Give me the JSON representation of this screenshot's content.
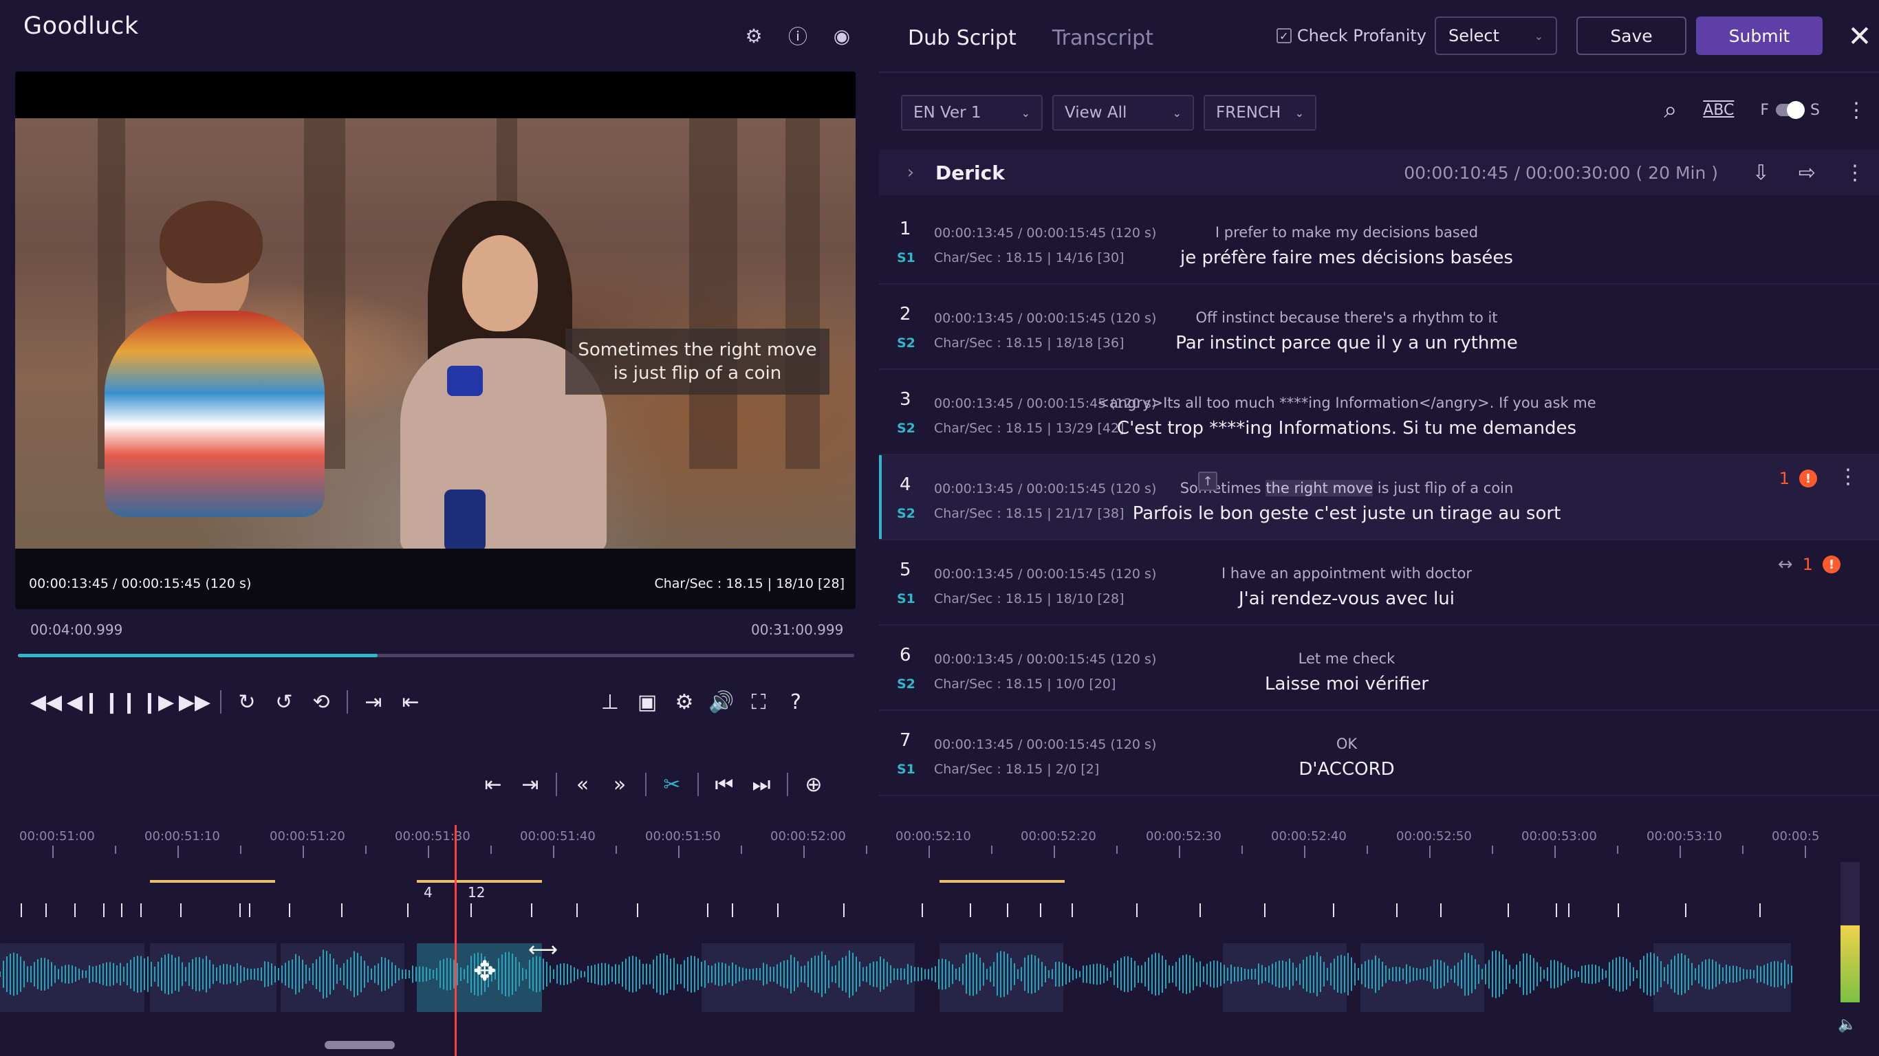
{
  "app": {
    "title": "Goodluck",
    "top_icons": [
      "gear-icon",
      "info-icon",
      "eye-icon"
    ]
  },
  "video": {
    "subtitle_line1": "Sometimes the right move",
    "subtitle_line2": "is just flip of a coin",
    "timecode": "00:00:13:45 / 00:00:15:45 (120 s)",
    "charsec": "Char/Sec : 18.15  |  18/10 [28]",
    "time_start": "00:04:00.999",
    "time_end": "00:31:00.999",
    "progress_percent": 43
  },
  "controls": {
    "row1_left": [
      {
        "name": "rewind-icon",
        "glyph": "◀◀"
      },
      {
        "name": "frame-back-icon",
        "glyph": "◀❙"
      },
      {
        "name": "pause-icon",
        "glyph": "❙❙"
      },
      {
        "name": "frame-forward-icon",
        "glyph": "❙▶"
      },
      {
        "name": "fast-forward-icon",
        "glyph": "▶▶"
      }
    ],
    "row1_mid": [
      {
        "name": "replay-10-icon",
        "glyph": "↻"
      },
      {
        "name": "forward-10-icon",
        "glyph": "↺"
      },
      {
        "name": "loop-icon",
        "glyph": "⟲"
      }
    ],
    "row1_mark": [
      {
        "name": "mark-in-icon",
        "glyph": "⇥"
      },
      {
        "name": "mark-out-icon",
        "glyph": "⇤"
      }
    ],
    "row1_right": [
      {
        "name": "pin-icon",
        "glyph": "⊥"
      },
      {
        "name": "subtitle-window-icon",
        "glyph": "▣"
      },
      {
        "name": "settings-icon",
        "glyph": "⚙"
      },
      {
        "name": "volume-icon",
        "glyph": "🔊"
      },
      {
        "name": "fullscreen-icon",
        "glyph": "⛶"
      },
      {
        "name": "help-icon",
        "glyph": "?"
      }
    ],
    "row2": [
      {
        "name": "extend-left-icon",
        "glyph": "⇤"
      },
      {
        "name": "extend-right-icon",
        "glyph": "⇥"
      },
      {
        "name": "prev-cue-icon",
        "glyph": "«"
      },
      {
        "name": "next-cue-icon",
        "glyph": "»"
      },
      {
        "name": "split-icon",
        "glyph": "✂"
      },
      {
        "name": "go-start-icon",
        "glyph": "⏮"
      },
      {
        "name": "go-end-icon",
        "glyph": "⏭"
      },
      {
        "name": "add-cue-icon",
        "glyph": "⊕"
      }
    ]
  },
  "header": {
    "tabs": [
      "Dub Script",
      "Transcript"
    ],
    "check_profanity": "Check Profanity",
    "select_label": "Select",
    "save_label": "Save",
    "submit_label": "Submit"
  },
  "filters": {
    "version": "EN Ver 1",
    "view": "View All",
    "language": "FRENCH",
    "toggle_left": "F",
    "toggle_right": "S",
    "spell_label": "ABC"
  },
  "speaker": {
    "name": "Derick",
    "time": "00:00:10:45 / 00:00:30:00 ( 20 Min )"
  },
  "lines": [
    {
      "num": "1",
      "spk": "S1",
      "time": "00:00:13:45 / 00:00:15:45 (120 s)",
      "cps": "Char/Sec : 18.15  |  14/16 [30]",
      "src": "I prefer to make  my decisions based",
      "tgt": "je préfère faire mes décisions basées"
    },
    {
      "num": "2",
      "spk": "S2",
      "time": "00:00:13:45 / 00:00:15:45 (120 s)",
      "cps": "Char/Sec : 18.15  |  18/18 [36]",
      "src": "Off instinct because there's a rhythm to it",
      "tgt": "Par instinct parce que il y a un rythme"
    },
    {
      "num": "3",
      "spk": "S2",
      "time": "00:00:13:45 / 00:00:15:45 (120 s)",
      "cps": "Char/Sec : 18.15  |  13/29 [42]",
      "src": "<angry>Its all too much ****ing Information</angry>. If you ask me",
      "tgt": "C'est trop ****ing Informations. Si tu me demandes"
    },
    {
      "num": "4",
      "spk": "S2",
      "time": "00:00:13:45 / 00:00:15:45 (120 s)",
      "cps": "Char/Sec : 18.15  |  21/17 [38]",
      "src_a": "Sometimes ",
      "src_hl": "the right move",
      "src_b": " is just flip of a coin",
      "tgt": "Parfois le bon geste c'est juste un tirage au sort",
      "badge": "1"
    },
    {
      "num": "5",
      "spk": "S1",
      "time": "00:00:13:45 / 00:00:15:45 (120 s)",
      "cps": "Char/Sec : 18.15  |  18/10 [28]",
      "src": "I have an appointment with doctor",
      "tgt": "J'ai rendez-vous avec lui",
      "badge": "1"
    },
    {
      "num": "6",
      "spk": "S2",
      "time": "00:00:13:45 / 00:00:15:45 (120 s)",
      "cps": "Char/Sec : 18.15  |  10/0 [20]",
      "src": "Let me check",
      "tgt": "Laisse moi vérifier"
    },
    {
      "num": "7",
      "spk": "S1",
      "time": "00:00:13:45 / 00:00:15:45 (120 s)",
      "cps": "Char/Sec : 18.15  |  2/0 [2]",
      "src": "OK",
      "tgt": "D'ACCORD"
    }
  ],
  "timeline": {
    "labels": [
      "00:00:51:00",
      "00:00:51:10",
      "00:00:51:20",
      "00:00:51:30",
      "00:00:51:40",
      "00:00:51:50",
      "00:00:52:00",
      "00:00:52:10",
      "00:00:52:20",
      "00:00:52:30",
      "00:00:52:40",
      "00:00:52:50",
      "00:00:53:00",
      "00:00:53:10",
      "00:00:5"
    ],
    "marker_a": "4",
    "marker_b": "12"
  }
}
